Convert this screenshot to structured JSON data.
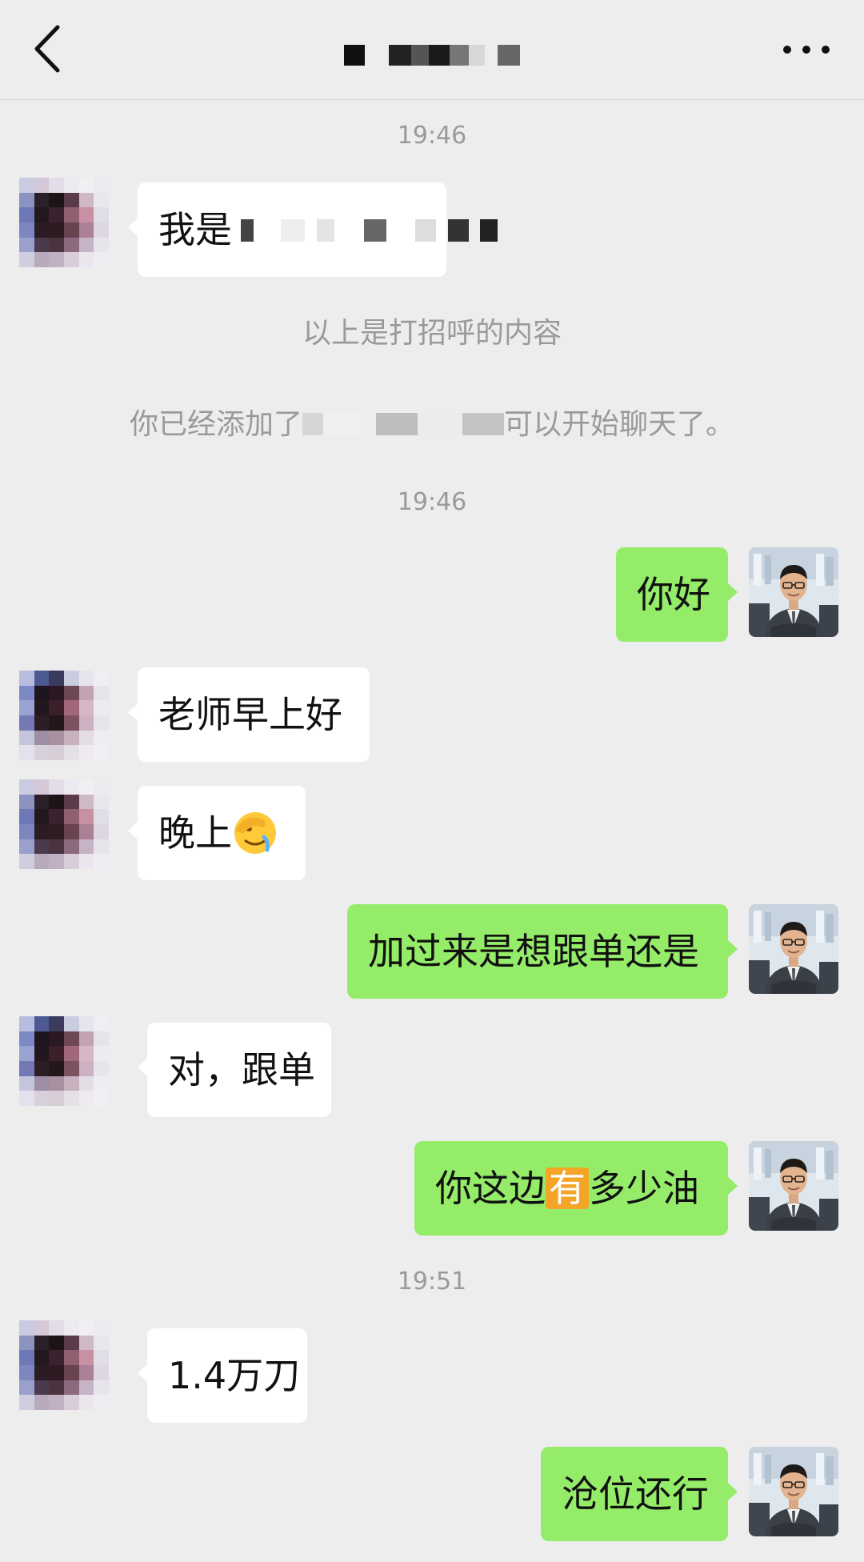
{
  "header": {
    "title": "",
    "back_icon": "chevron-left-icon",
    "more_icon": "more-dots-icon"
  },
  "messages": [
    {
      "type": "time",
      "text": "19:46"
    },
    {
      "type": "msg",
      "side": "left",
      "text_prefix": "我是",
      "note": "rest of greeting pixelated"
    },
    {
      "type": "system",
      "text": "以上是打招呼的内容"
    },
    {
      "type": "system",
      "text_prefix": "你已经添加了",
      "text_suffix": "可以开始聊天了。"
    },
    {
      "type": "time",
      "text": "19:46"
    },
    {
      "type": "msg",
      "side": "right",
      "text": "你好"
    },
    {
      "type": "msg",
      "side": "left",
      "text": "老师早上好"
    },
    {
      "type": "msg",
      "side": "left",
      "text": "晚上",
      "emoji": "facepalm-emoji"
    },
    {
      "type": "msg",
      "side": "right",
      "text": "加过来是想跟单还是"
    },
    {
      "type": "msg",
      "side": "left",
      "text": "对，跟单"
    },
    {
      "type": "msg",
      "side": "right",
      "text_pre": "你这边",
      "highlight": "有",
      "text_post": "多少油"
    },
    {
      "type": "time",
      "text": "19:51"
    },
    {
      "type": "msg",
      "side": "left",
      "text": "1.4万刀"
    },
    {
      "type": "msg",
      "side": "right",
      "text": "沧位还行"
    }
  ],
  "colors": {
    "background": "#ededed",
    "bubble_self": "#95ec69",
    "bubble_other": "#ffffff",
    "meta_text": "#9a9a9a",
    "highlight": "#f4a426"
  }
}
